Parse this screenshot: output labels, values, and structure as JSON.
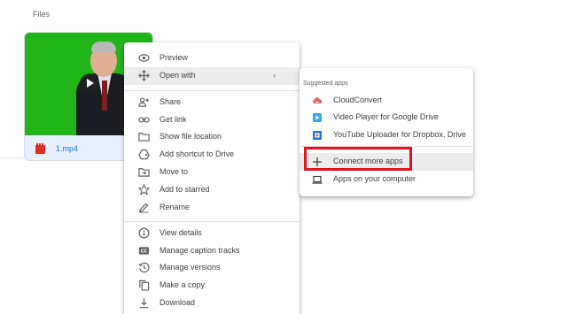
{
  "files_section": {
    "title": "Files"
  },
  "file": {
    "name": "1.mp4"
  },
  "context_menu": {
    "items": [
      {
        "label": "Preview",
        "icon": "eye-icon"
      },
      {
        "label": "Open with",
        "icon": "move-arrows-icon",
        "submenu_arrow": "›"
      },
      {
        "label": "Share",
        "icon": "person-add-icon"
      },
      {
        "label": "Get link",
        "icon": "link-icon"
      },
      {
        "label": "Show file location",
        "icon": "folder-icon"
      },
      {
        "label": "Add shortcut to Drive",
        "icon": "drive-shortcut-icon"
      },
      {
        "label": "Move to",
        "icon": "move-to-folder-icon"
      },
      {
        "label": "Add to starred",
        "icon": "star-icon"
      },
      {
        "label": "Rename",
        "icon": "pencil-icon"
      },
      {
        "label": "View details",
        "icon": "info-icon"
      },
      {
        "label": "Manage caption tracks",
        "icon": "captions-icon"
      },
      {
        "label": "Manage versions",
        "icon": "history-icon"
      },
      {
        "label": "Make a copy",
        "icon": "copy-icon"
      },
      {
        "label": "Download",
        "icon": "download-icon"
      }
    ]
  },
  "open_with_submenu": {
    "header": "Suggested apps",
    "apps": [
      {
        "label": "CloudConvert",
        "icon": "cloudconvert-icon"
      },
      {
        "label": "Video Player for Google Drive",
        "icon": "video-player-icon"
      },
      {
        "label": "YouTube Uploader for Dropbox, Drive",
        "icon": "youtube-uploader-icon"
      }
    ],
    "connect_more": {
      "label": "Connect more apps",
      "icon": "plus-icon"
    },
    "computer_apps": {
      "label": "Apps on your computer",
      "icon": "laptop-icon"
    }
  },
  "colors": {
    "highlight": "#e0131f",
    "link_blue": "#1a73e8",
    "thumbnail_green": "#22b519",
    "menu_hover": "#ececec"
  }
}
